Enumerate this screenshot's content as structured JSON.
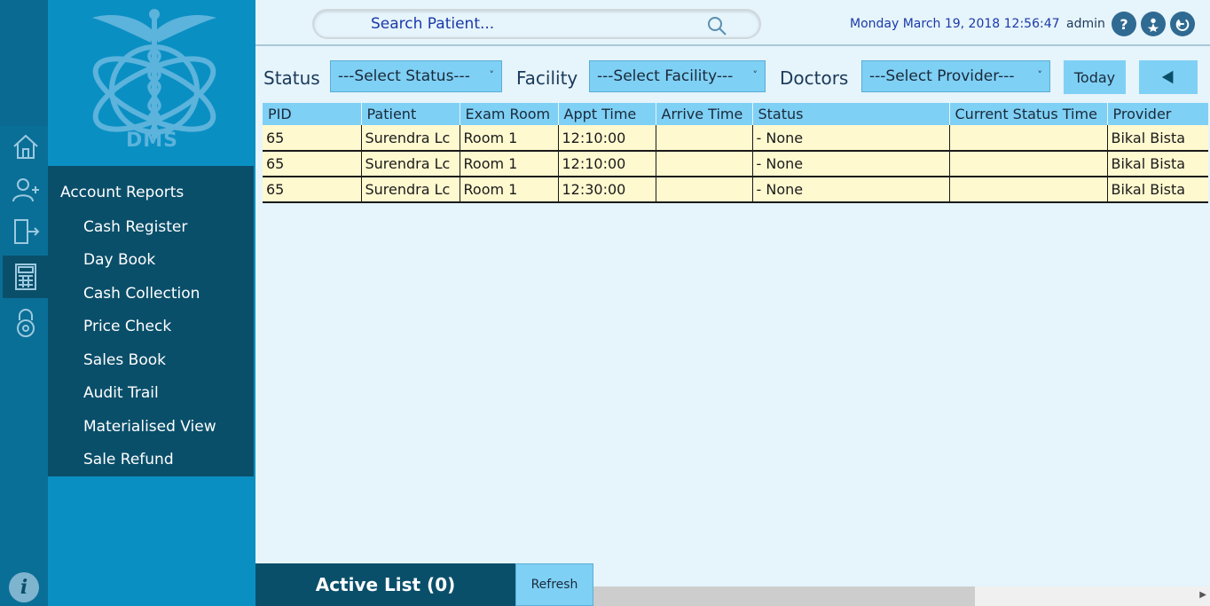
{
  "sidebar": {
    "logo_text": "DMS",
    "menu_title": "Account Reports",
    "items": [
      "Cash Register",
      "Day Book",
      "Cash Collection",
      "Price Check",
      "Sales Book",
      "Audit Trail",
      "Materialised View",
      "Sale Refund"
    ]
  },
  "header": {
    "search_placeholder": "Search Patient...",
    "datetime": "Monday March 19, 2018 12:56:47",
    "user": "admin"
  },
  "filters": {
    "status_label": "Status",
    "status_value": "---Select Status---",
    "facility_label": "Facility",
    "facility_value": "---Select Facility---",
    "doctors_label": "Doctors",
    "doctors_value": "---Select Provider---",
    "today_label": "Today"
  },
  "table": {
    "columns": [
      "PID",
      "Patient",
      "Exam Room",
      "Appt Time",
      "Arrive Time",
      "Status",
      "Current Status Time",
      "Provider"
    ],
    "rows": [
      [
        "65",
        "Surendra  Lc",
        "Room 1",
        "12:10:00",
        "",
        "- None",
        "",
        "Bikal  Bista"
      ],
      [
        "65",
        "Surendra  Lc",
        "Room 1",
        "12:10:00",
        "",
        "- None",
        "",
        "Bikal  Bista"
      ],
      [
        "65",
        "Surendra  Lc",
        "Room 1",
        "12:30:00",
        "",
        "- None",
        "",
        "Bikal  Bista"
      ]
    ]
  },
  "footer": {
    "active_list": "Active List (0)",
    "refresh": "Refresh"
  }
}
